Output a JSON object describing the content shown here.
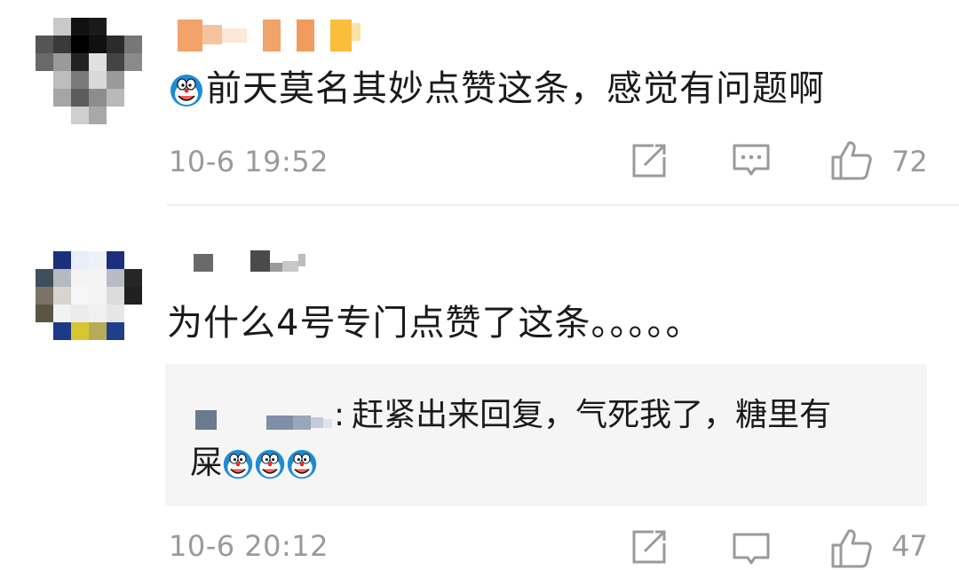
{
  "comments": [
    {
      "text": "前天莫名其妙点赞这条，感觉有问题啊",
      "timestamp": "10-6 19:52",
      "like_count": "72",
      "leading_emoji": "doraemon-emoji"
    },
    {
      "text": "为什么4号专门点赞了这条。。。。。",
      "reply": {
        "separator": ":",
        "text_line1": "赶紧出来回复，气死我了，糖里有",
        "text_line2": "屎",
        "emoji_count": 3,
        "emoji": "doraemon-emoji"
      },
      "timestamp": "10-6 20:12",
      "like_count": "47"
    }
  ],
  "icons": {
    "share": "share-icon",
    "comment": "comment-icon",
    "like": "thumbs-up-icon"
  },
  "colors": {
    "meta_text": "#9a9a9a",
    "reply_bg": "#f5f5f5",
    "icon_stroke": "#9a9a9a"
  }
}
